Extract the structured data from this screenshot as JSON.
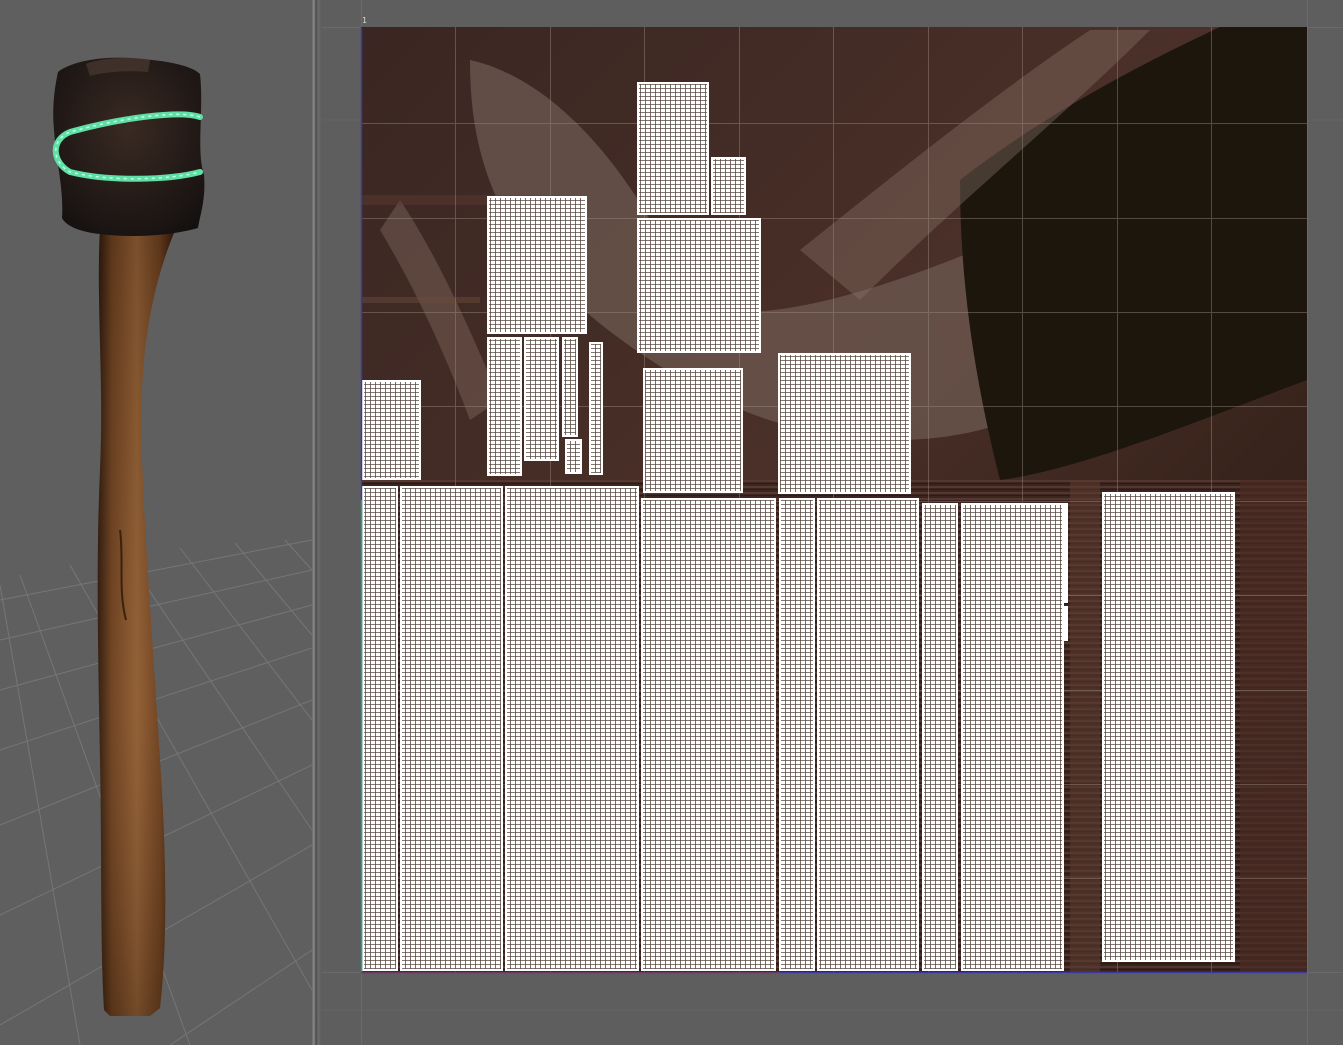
{
  "viewport3d": {
    "object": "wooden-club",
    "selection_highlight": "#5ee0a6",
    "grid_color": "#7a7a7a",
    "background": "#5f5f5f"
  },
  "uv_editor": {
    "background": "#5e5e5e",
    "grid_color": "#6e6e6e",
    "texture_dark": "#2a1a14",
    "texture_light": "#7a6256",
    "uv_shell_color": "#ffffff",
    "u_axis_color": "#3a3aa0",
    "v_axis_color": "#3aa05a",
    "origin_marker": "1"
  }
}
